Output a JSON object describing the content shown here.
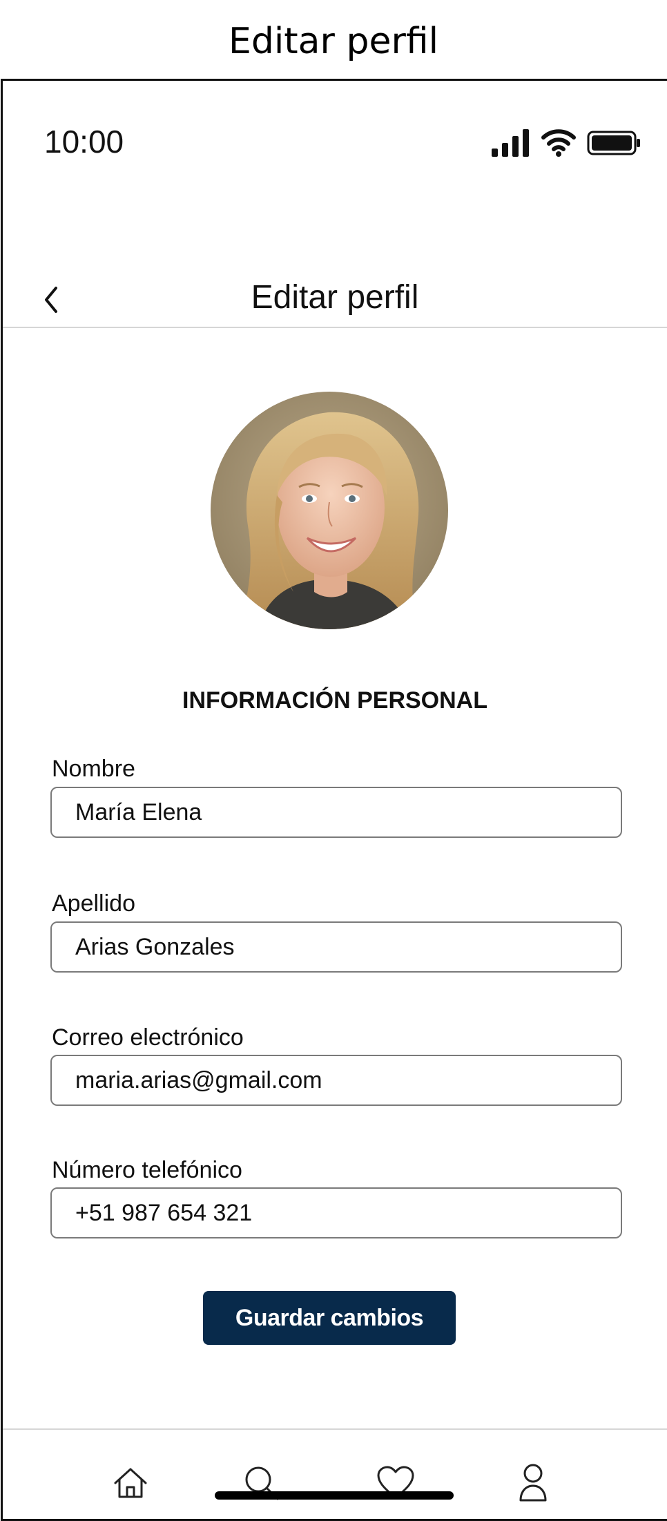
{
  "caption": "Editar perfil",
  "status_bar": {
    "time": "10:00",
    "icons": [
      "cellular-signal-icon",
      "wifi-icon",
      "battery-icon"
    ]
  },
  "header": {
    "back_icon": "chevron-left-icon",
    "title": "Editar perfil"
  },
  "profile": {
    "avatar": "profile-photo"
  },
  "section_title": "INFORMACIÓN PERSONAL",
  "form": {
    "nombre": {
      "label": "Nombre",
      "value": "María Elena"
    },
    "apellido": {
      "label": "Apellido",
      "value": "Arias Gonzales"
    },
    "correo": {
      "label": "Correo electrónico",
      "value": "maria.arias@gmail.com"
    },
    "telefono": {
      "label": "Número telefónico",
      "value": "+51 987 654 321"
    }
  },
  "save_button": {
    "label": "Guardar cambios"
  },
  "tab_bar": {
    "items": [
      "home-icon",
      "search-icon",
      "heart-icon",
      "user-icon"
    ]
  },
  "colors": {
    "primary": "#082a4b",
    "border": "#7a7a7a",
    "divider": "#d6d6d6",
    "text": "#111111"
  }
}
